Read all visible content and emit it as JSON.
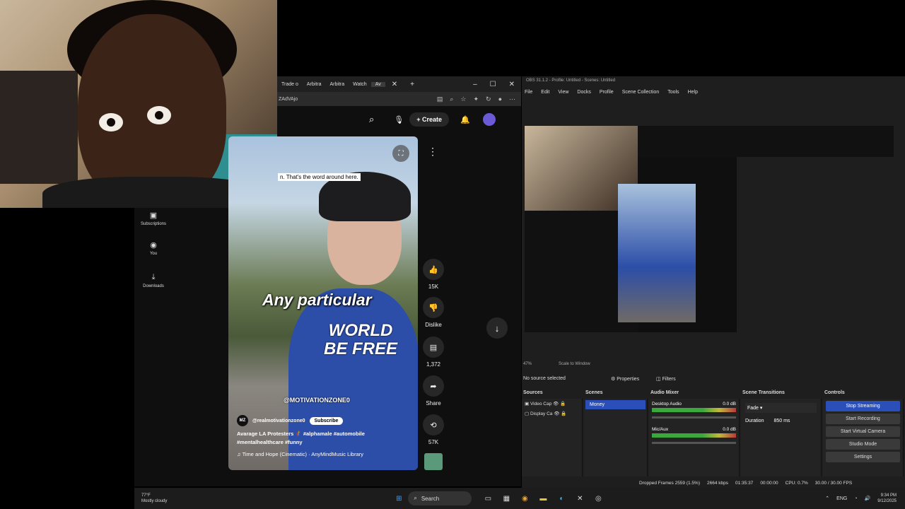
{
  "browser": {
    "tabs": [
      "Trade o",
      "Arbitra",
      "Arbitra",
      "Watch",
      "Av"
    ],
    "url_fragment": "ZAdVAjo",
    "create_label": "Create"
  },
  "yt_nav": [
    {
      "label": "Subscriptions",
      "icon": "subscriptions-icon"
    },
    {
      "label": "You",
      "icon": "user-icon"
    },
    {
      "label": "Downloads",
      "icon": "download-icon"
    }
  ],
  "short": {
    "caption_top": "n. That's the word around here.",
    "overlay_text": "Any particular",
    "shirt_print": "WORLD BE FREE",
    "watermark": "@MOTIVATIONZONE0",
    "channel_badge": "MZ",
    "handle": "@realmotivationzone0",
    "subscribe_label": "Subscribe",
    "description": "Avarage LA Protesters 🦸 #alphamale #automobile #mentalhealthcare #funny",
    "music": "♫ Time and Hope (Cinematic) · AnyMindMusic Library"
  },
  "actions": [
    {
      "label": "15K",
      "icon": "thumbs-up-icon"
    },
    {
      "label": "Dislike",
      "icon": "thumbs-down-icon"
    },
    {
      "label": "1,372",
      "icon": "comment-icon"
    },
    {
      "label": "Share",
      "icon": "share-icon"
    },
    {
      "label": "57K",
      "icon": "remix-icon"
    }
  ],
  "obs": {
    "title": "OBS 31.1.2 - Profile: Untitled - Scenes: Untitled",
    "menu": [
      "File",
      "Edit",
      "View",
      "Docks",
      "Profile",
      "Scene Collection",
      "Tools",
      "Help"
    ],
    "zoom": "47%",
    "scale_label": "Scale to Window",
    "no_source": "No source selected",
    "properties": "Properties",
    "filters": "Filters",
    "panels": {
      "sources": "Sources",
      "scenes": "Scenes",
      "audio_mixer": "Audio Mixer",
      "transitions": "Scene Transitions",
      "controls": "Controls"
    },
    "sources": [
      "Video Cap",
      "Display Ca"
    ],
    "scene_active": "Money",
    "audio": [
      {
        "name": "Desktop Audio",
        "db": "0.0 dB",
        "level": 0.72
      },
      {
        "name": "Mic/Aux",
        "db": "0.0 dB",
        "level": 0.58
      }
    ],
    "transition": "Fade",
    "duration_label": "Duration",
    "duration_value": "850 ms",
    "controls": [
      "Stop Streaming",
      "Start Recording",
      "Start Virtual Camera",
      "Studio Mode",
      "Settings"
    ],
    "status": {
      "dropped": "Dropped Frames 2559 (1.5%)",
      "bitrate": "2664 kbps",
      "stream_time": "01:35:37",
      "rec_time": "00:00:00",
      "cpu": "CPU: 0.7%",
      "fps": "30.00 / 30.00 FPS"
    }
  },
  "taskbar": {
    "weather_temp": "77°F",
    "weather_desc": "Mostly cloudy",
    "search_label": "Search",
    "lang": "ENG",
    "time": "9:34 PM",
    "date": "9/12/2025"
  }
}
